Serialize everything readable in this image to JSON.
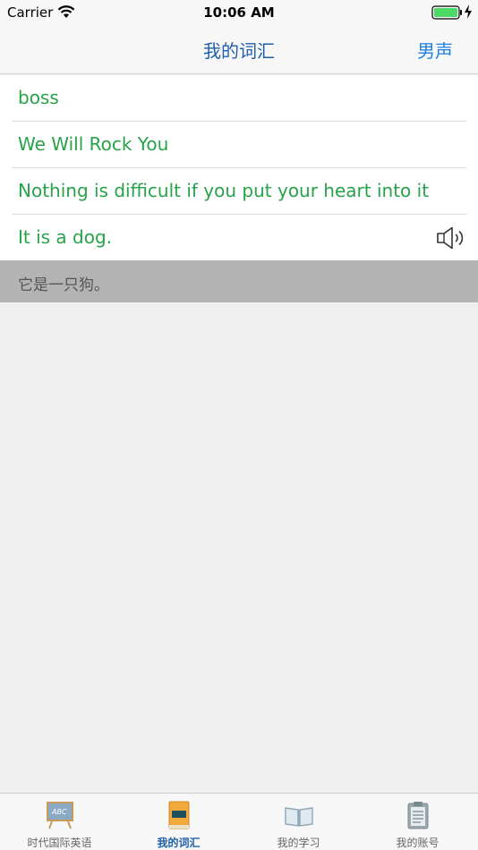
{
  "status": {
    "carrier": "Carrier",
    "time": "10:06 AM"
  },
  "nav": {
    "title": "我的词汇",
    "right_button": "男声"
  },
  "vocab": [
    {
      "text": "boss"
    },
    {
      "text": "We Will Rock You"
    },
    {
      "text": "Nothing is difficult if you put your heart into it"
    },
    {
      "text": "It is a dog.",
      "speaker": true
    }
  ],
  "translation": "它是一只狗。",
  "tabs": [
    {
      "label": "时代国际英语",
      "icon": "chalkboard-icon"
    },
    {
      "label": "我的词汇",
      "icon": "vocabulary-book-icon",
      "active": true
    },
    {
      "label": "我的学习",
      "icon": "open-book-icon"
    },
    {
      "label": "我的账号",
      "icon": "clipboard-icon"
    }
  ],
  "colors": {
    "accent": "#1f5fa8",
    "nav_button": "#1d7fe0",
    "vocab_text": "#27a349",
    "translation_bg": "#b3b3b3"
  }
}
